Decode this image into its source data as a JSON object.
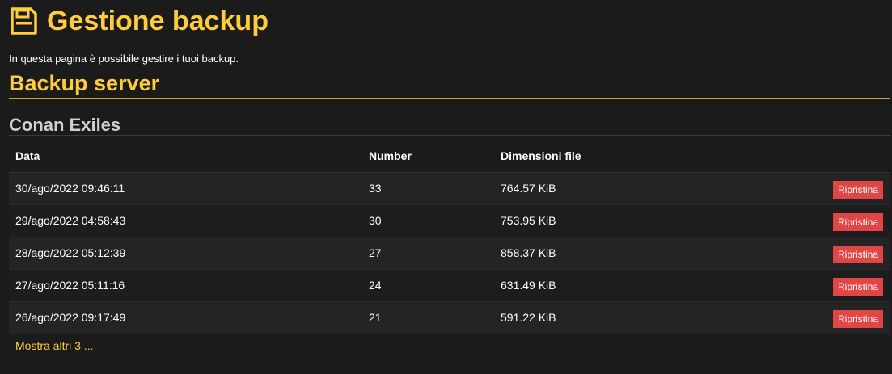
{
  "header": {
    "title": "Gestione backup",
    "icon": "floppy-disk-icon",
    "intro": "In questa pagina è possibile gestire i tuoi backup."
  },
  "section": {
    "title": "Backup server"
  },
  "server": {
    "name": "Conan Exiles",
    "columns": {
      "date": "Data",
      "number": "Number",
      "size": "Dimensioni file"
    },
    "rows": [
      {
        "date": "30/ago/2022 09:46:11",
        "number": "33",
        "size": "764.57 KiB",
        "action": "Ripristina"
      },
      {
        "date": "29/ago/2022 04:58:43",
        "number": "30",
        "size": "753.95 KiB",
        "action": "Ripristina"
      },
      {
        "date": "28/ago/2022 05:12:39",
        "number": "27",
        "size": "858.37 KiB",
        "action": "Ripristina"
      },
      {
        "date": "27/ago/2022 05:11:16",
        "number": "24",
        "size": "631.49 KiB",
        "action": "Ripristina"
      },
      {
        "date": "26/ago/2022 09:17:49",
        "number": "21",
        "size": "591.22 KiB",
        "action": "Ripristina"
      }
    ],
    "more_link": "Mostra altri 3 ..."
  },
  "colors": {
    "accent": "#ffcd3c",
    "danger": "#e04646",
    "background": "#1b1b1b"
  }
}
